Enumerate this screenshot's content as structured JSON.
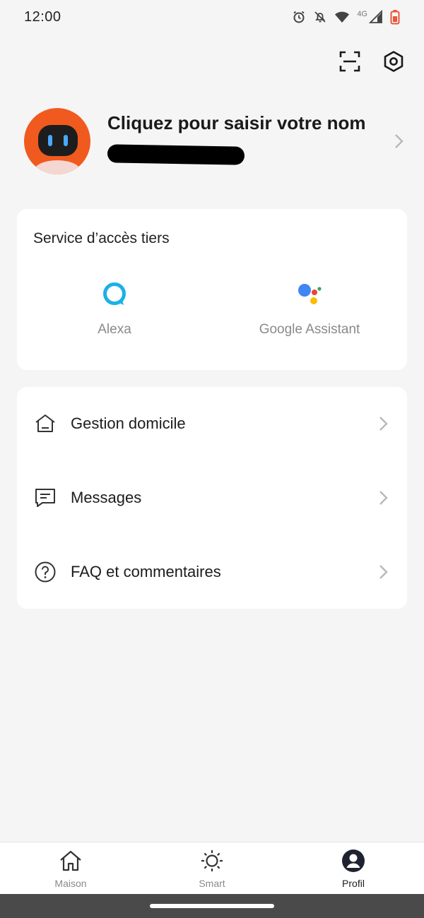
{
  "status_bar": {
    "time": "12:00",
    "network_label": "4G",
    "icons": [
      "alarm-icon",
      "notifications-off-icon",
      "wifi-icon",
      "signal-icon",
      "battery-icon"
    ]
  },
  "top_actions": {
    "scan_icon": "scan-icon",
    "settings_icon": "settings-icon"
  },
  "profile": {
    "name_prompt": "Cliquez pour saisir votre nom",
    "account_redacted": true
  },
  "third_party": {
    "title": "Service d’accès tiers",
    "services": [
      {
        "label": "Alexa",
        "icon": "alexa-icon"
      },
      {
        "label": "Google Assistant",
        "icon": "google-assistant-icon"
      }
    ]
  },
  "menu": {
    "items": [
      {
        "label": "Gestion domicile",
        "icon": "home-icon"
      },
      {
        "label": "Messages",
        "icon": "message-icon"
      },
      {
        "label": "FAQ et commentaires",
        "icon": "help-icon"
      }
    ]
  },
  "bottom_nav": {
    "items": [
      {
        "label": "Maison",
        "icon": "house-icon",
        "active": false
      },
      {
        "label": "Smart",
        "icon": "sun-icon",
        "active": false
      },
      {
        "label": "Profil",
        "icon": "profile-icon",
        "active": true
      }
    ]
  },
  "colors": {
    "background": "#f5f5f5",
    "card": "#ffffff",
    "avatar": "#f05a1f",
    "alexa": "#1ab1e6",
    "battery": "#e8573a",
    "system_bar": "#4a4a4a"
  }
}
